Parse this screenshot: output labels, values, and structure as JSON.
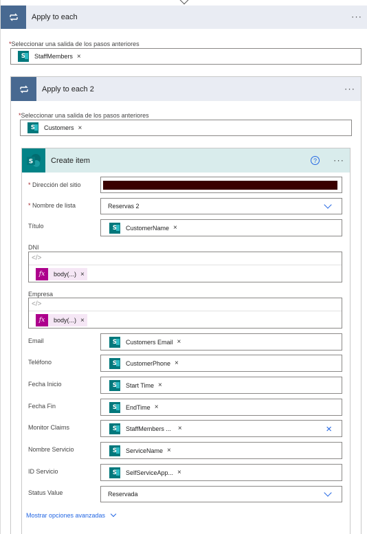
{
  "outer": {
    "title": "Apply to each",
    "more": "···",
    "select_label": "Seleccionar una salida de los pasos anteriores",
    "token": "StaffMembers"
  },
  "inner": {
    "title": "Apply to each 2",
    "more": "···",
    "select_label": "Seleccionar una salida de los pasos anteriores",
    "token": "Customers"
  },
  "create": {
    "title": "Create item",
    "help": "?",
    "more": "···"
  },
  "fields": {
    "site": {
      "label": "Dirección del sitio"
    },
    "list": {
      "label": "Nombre de lista",
      "value": "Reservas 2"
    },
    "titulo": {
      "label": "Título",
      "token": "CustomerName"
    },
    "dni": {
      "label": "DNI",
      "code": "</>",
      "token": "body(...)"
    },
    "empresa": {
      "label": "Empresa",
      "code": "</>",
      "token": "body(...)"
    },
    "email": {
      "label": "Email",
      "token": "Customers Email"
    },
    "telefono": {
      "label": "Teléfono",
      "token": "CustomerPhone"
    },
    "fecha_inicio": {
      "label": "Fecha Inicio",
      "token": "Start Time"
    },
    "fecha_fin": {
      "label": "Fecha Fin",
      "token": "EndTime"
    },
    "monitor": {
      "label": "Monitor Claims",
      "token": "StaffMembers ..."
    },
    "servicio": {
      "label": "Nombre Servicio",
      "token": "ServiceName"
    },
    "id_servicio": {
      "label": "ID Servicio",
      "token": "SelfServiceApp..."
    },
    "status": {
      "label": "Status Value",
      "value": "Reservada"
    }
  },
  "advanced": "Mostrar opciones avanzadas",
  "common": {
    "remove": "×",
    "required": "*",
    "fx": "fx",
    "sp": "S"
  },
  "colors": {
    "loop_header": "#486991",
    "sharepoint": "#03787c",
    "expression": "#ad008c",
    "link": "#2266e3",
    "site_redacted": "#3a0000"
  }
}
